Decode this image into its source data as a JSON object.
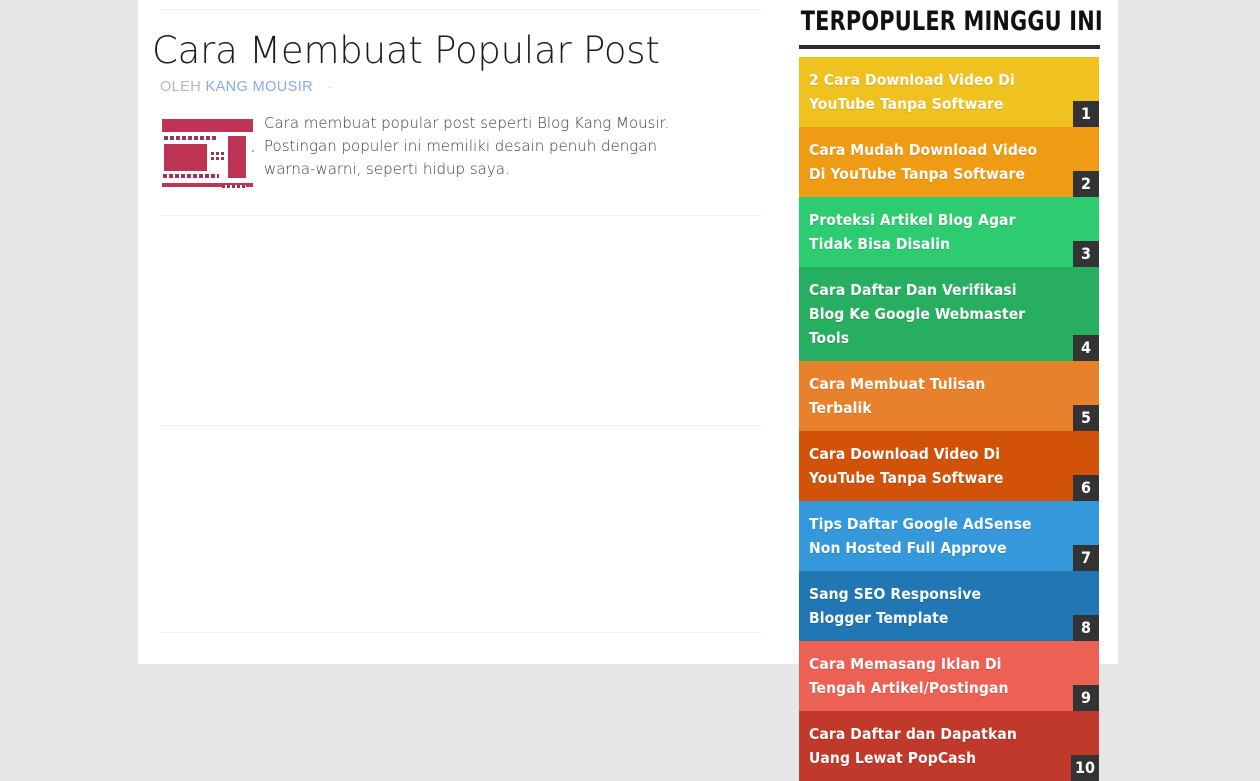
{
  "theme": {
    "page_background": "#e6e6e6",
    "canvas_background": "#ffffff",
    "rule_color": "#f2f2f2",
    "rank_badge_background": "#333333",
    "widget_rule_color": "#2b2b2b",
    "author_link_color": "#8aa9e8",
    "thumbnail_accent": "#bf3355"
  },
  "article": {
    "title": "Cara Membuat Popular Post",
    "byline_prefix": "OLEH",
    "byline_author": "KANG MOUSIR",
    "byline_separator": "·",
    "snippet": "Cara membuat popular post seperti Blog Kang Mousir. Postingan populer ini memiliki desain penuh dengan warna-warni, seperti hidup saya.",
    "thumbnail_name": "post-thumbnail-template-preview"
  },
  "sidebar": {
    "widget_title": "TERPOPULER MINGGU INI",
    "popular_posts": [
      {
        "rank": "1",
        "title": "2 Cara Download Video Di YouTube Tanpa Software",
        "color": "#efc220",
        "lines": 2
      },
      {
        "rank": "2",
        "title": "Cara Mudah Download Video Di YouTube Tanpa Software",
        "color": "#ef9b14",
        "lines": 2
      },
      {
        "rank": "3",
        "title": "Proteksi Artikel Blog Agar Tidak Bisa Disalin",
        "color": "#2ecc71",
        "lines": 2
      },
      {
        "rank": "4",
        "title": "Cara Daftar Dan Verifikasi Blog Ke Google Webmaster Tools",
        "color": "#27ae60",
        "lines": 2
      },
      {
        "rank": "5",
        "title": "Cara Membuat Tulisan Terbalik",
        "color": "#e8812b",
        "lines": 1
      },
      {
        "rank": "6",
        "title": "Cara Download Video Di YouTube Tanpa Software",
        "color": "#d3520a",
        "lines": 2
      },
      {
        "rank": "7",
        "title": "Tips Daftar Google AdSense Non Hosted Full Approve",
        "color": "#3498db",
        "lines": 2
      },
      {
        "rank": "8",
        "title": "Sang SEO Responsive Blogger Template",
        "color": "#2077b4",
        "lines": 2
      },
      {
        "rank": "9",
        "title": "Cara Memasang Iklan Di Tengah Artikel/Postingan",
        "color": "#ec6154",
        "lines": 2
      },
      {
        "rank": "10",
        "title": "Cara Daftar dan Dapatkan Uang Lewat PopCash",
        "color": "#c0392b",
        "lines": 2
      }
    ]
  }
}
